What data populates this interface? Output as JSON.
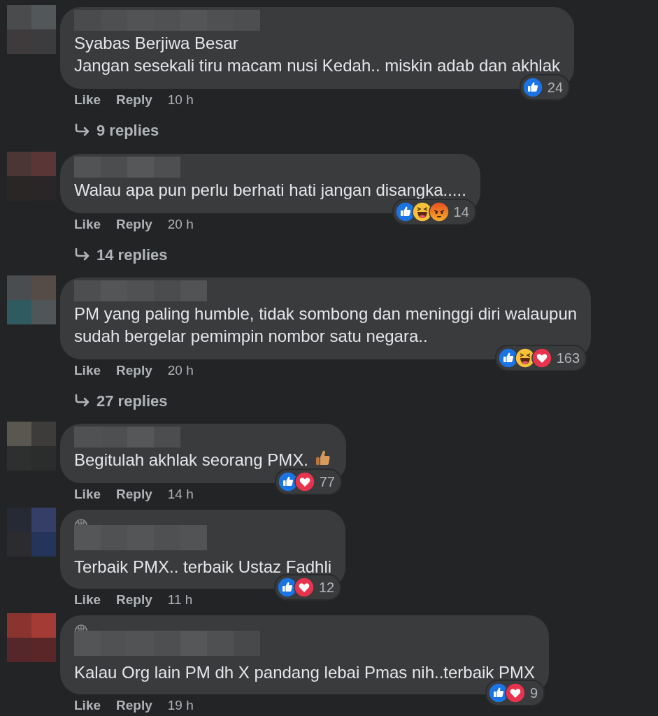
{
  "comments": [
    {
      "lines": [
        "Syabas Berjiwa Besar",
        "Jangan sesekali tiru macam nusi Kedah.. miskin adab dan akhlak"
      ],
      "reactions": [
        {
          "kind": "like"
        }
      ],
      "reaction_count": "24",
      "actions": [
        "Like",
        "Reply"
      ],
      "time": "10 h",
      "replies": "9 replies"
    },
    {
      "lines": [
        "Walau apa pun perlu berhati hati jangan disangka....."
      ],
      "reactions": [
        {
          "kind": "like"
        },
        {
          "kind": "haha"
        },
        {
          "kind": "angry"
        }
      ],
      "reaction_count": "14",
      "actions": [
        "Like",
        "Reply"
      ],
      "time": "20 h",
      "replies": "14 replies"
    },
    {
      "lines": [
        "PM yang paling humble, tidak sombong dan meninggi diri walaupun",
        "sudah bergelar pemimpin nombor satu negara.."
      ],
      "reactions": [
        {
          "kind": "like"
        },
        {
          "kind": "haha"
        },
        {
          "kind": "love"
        }
      ],
      "reaction_count": "163",
      "actions": [
        "Like",
        "Reply"
      ],
      "time": "20 h",
      "replies": "27 replies"
    },
    {
      "lines": [
        "Begitulah akhlak seorang PMX."
      ],
      "emoji": {
        "kind": "thumbs_up"
      },
      "reactions": [
        {
          "kind": "like"
        },
        {
          "kind": "love"
        }
      ],
      "reaction_count": "77",
      "actions": [
        "Like",
        "Reply"
      ],
      "time": "14 h"
    },
    {
      "badge": {
        "kind": "top_fan"
      },
      "lines": [
        "Terbaik PMX.. terbaik Ustaz Fadhli"
      ],
      "reactions": [
        {
          "kind": "like"
        },
        {
          "kind": "love"
        }
      ],
      "reaction_count": "12",
      "actions": [
        "Like",
        "Reply"
      ],
      "time": "11 h"
    },
    {
      "badge": {
        "kind": "top_fan"
      },
      "lines": [
        "Kalau Org lain PM dh X pandang lebai Pmas nih..terbaik PMX"
      ],
      "reactions": [
        {
          "kind": "like"
        },
        {
          "kind": "love"
        }
      ],
      "reaction_count": "9",
      "actions": [
        "Like",
        "Reply"
      ],
      "time": "19 h"
    }
  ]
}
